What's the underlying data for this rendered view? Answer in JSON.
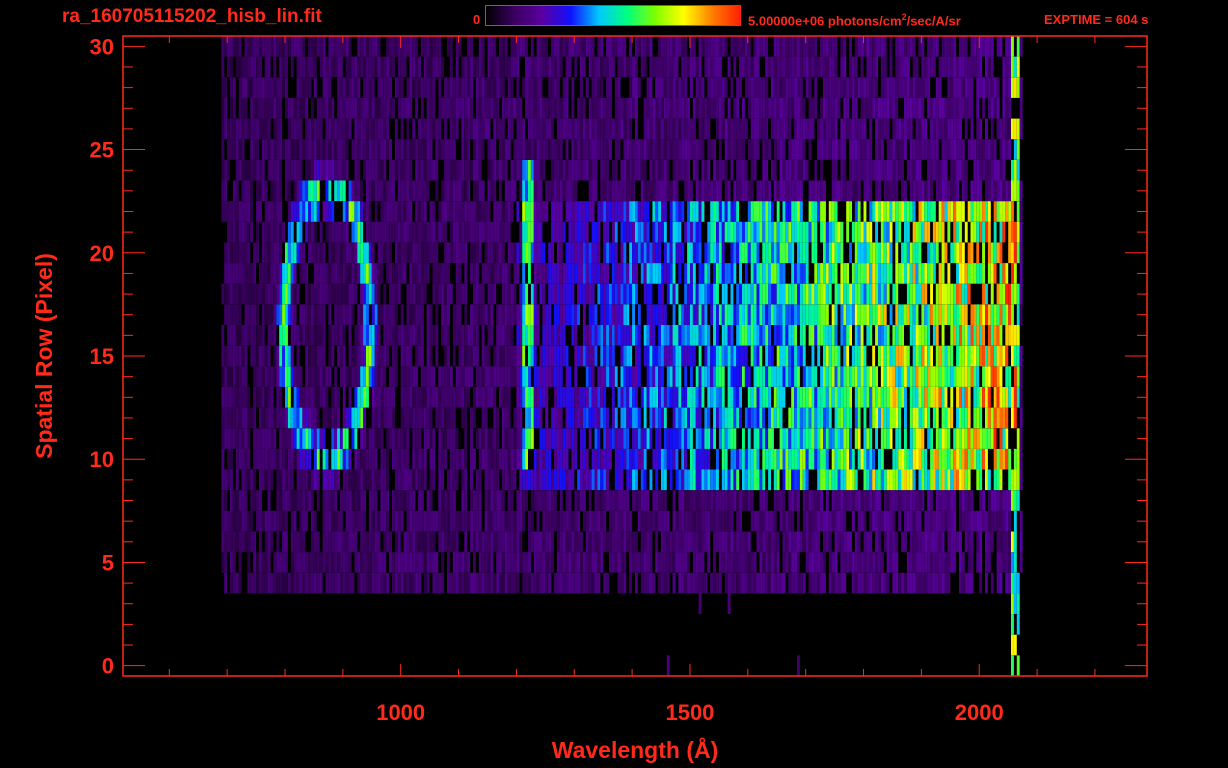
{
  "header": {
    "filename": "ra_160705115202_hisb_lin.fit",
    "colorbar_min": "0",
    "colorbar_max_label": "5.00000e+06 photons/cm",
    "colorbar_sup": "2",
    "colorbar_max_unit": "/sec/A/sr",
    "exptime": "EXPTIME = 604 s"
  },
  "colors": {
    "axis": "#ff2a1a",
    "background": "#000000",
    "colormap": [
      "#000000",
      "#3a0060",
      "#5a00a0",
      "#1010ff",
      "#00c8ff",
      "#00ff80",
      "#80ff00",
      "#ffff00",
      "#ff8000",
      "#ff2000"
    ]
  },
  "chart_data": {
    "type": "heatmap",
    "title": "ra_160705115202_hisb_lin.fit",
    "xlabel": "Wavelength (Å)",
    "ylabel": "Spatial Row (Pixel)",
    "xlim": [
      520,
      2290
    ],
    "ylim": [
      -0.5,
      30.5
    ],
    "x_ticks": [
      1000,
      1500,
      2000
    ],
    "x_tick_labels": [
      "1000",
      "1500",
      "2000"
    ],
    "y_ticks": [
      0,
      5,
      10,
      15,
      20,
      25,
      30
    ],
    "y_tick_labels": [
      "0",
      "5",
      "10",
      "15",
      "20",
      "25",
      "30"
    ],
    "colorbar_range": [
      0,
      5000000
    ],
    "colorbar_unit": "photons/cm²/sec/A/sr",
    "exptime_s": 604,
    "grid": false,
    "features": [
      {
        "kind": "ring",
        "x_center": 870,
        "y_center": 16.5,
        "x_radius": 75,
        "y_radius": 6.5,
        "relative_intensity": 0.55
      },
      {
        "kind": "emission_line",
        "x": 1216,
        "y_range": [
          10,
          24
        ],
        "relative_intensity": 0.55
      },
      {
        "kind": "continuum",
        "x_range": [
          1500,
          2060
        ],
        "y_range": [
          9,
          22
        ],
        "relative_intensity": 0.8
      },
      {
        "kind": "band_edge",
        "x": 2060,
        "y_range": [
          0,
          30
        ],
        "relative_intensity": 0.9
      }
    ]
  }
}
